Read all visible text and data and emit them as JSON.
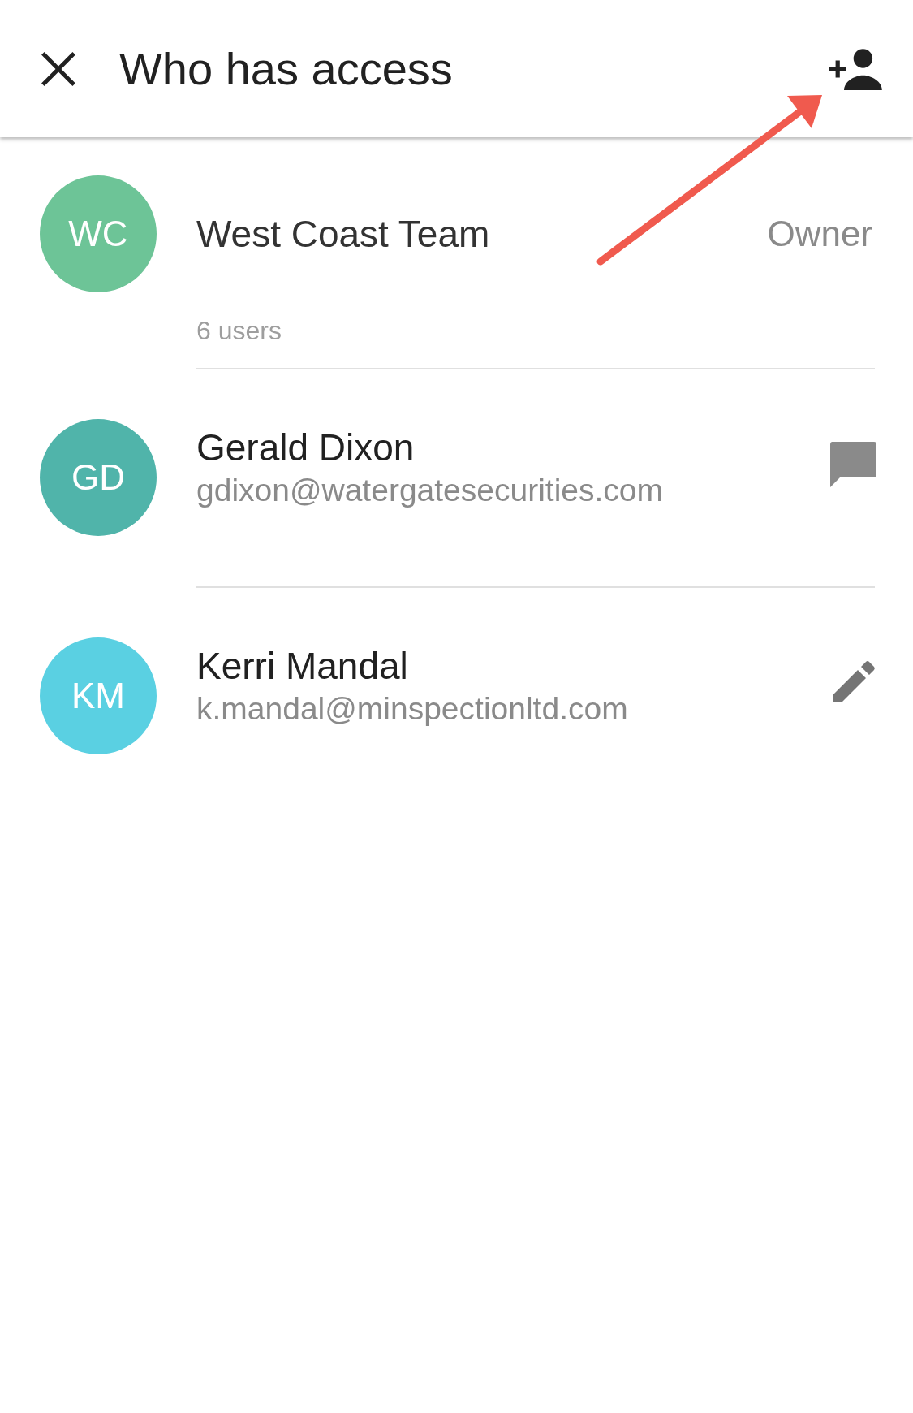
{
  "header": {
    "title": "Who has access"
  },
  "members": [
    {
      "kind": "group",
      "initials": "WC",
      "color": "#6dc497",
      "name": "West Coast Team",
      "role": "Owner",
      "subtitle": "6 users"
    },
    {
      "kind": "person",
      "initials": "GD",
      "color": "#50b4aa",
      "name": "Gerald Dixon",
      "email": "gdixon@watergatesecurities.com",
      "action": {
        "kind": "chat"
      }
    },
    {
      "kind": "person",
      "initials": "KM",
      "color": "#5ad0e2",
      "name": "Kerri Mandal",
      "email": "k.mandal@minspectionltd.com",
      "action": {
        "kind": "edit"
      }
    }
  ],
  "annotation": {
    "kind": "arrow"
  }
}
